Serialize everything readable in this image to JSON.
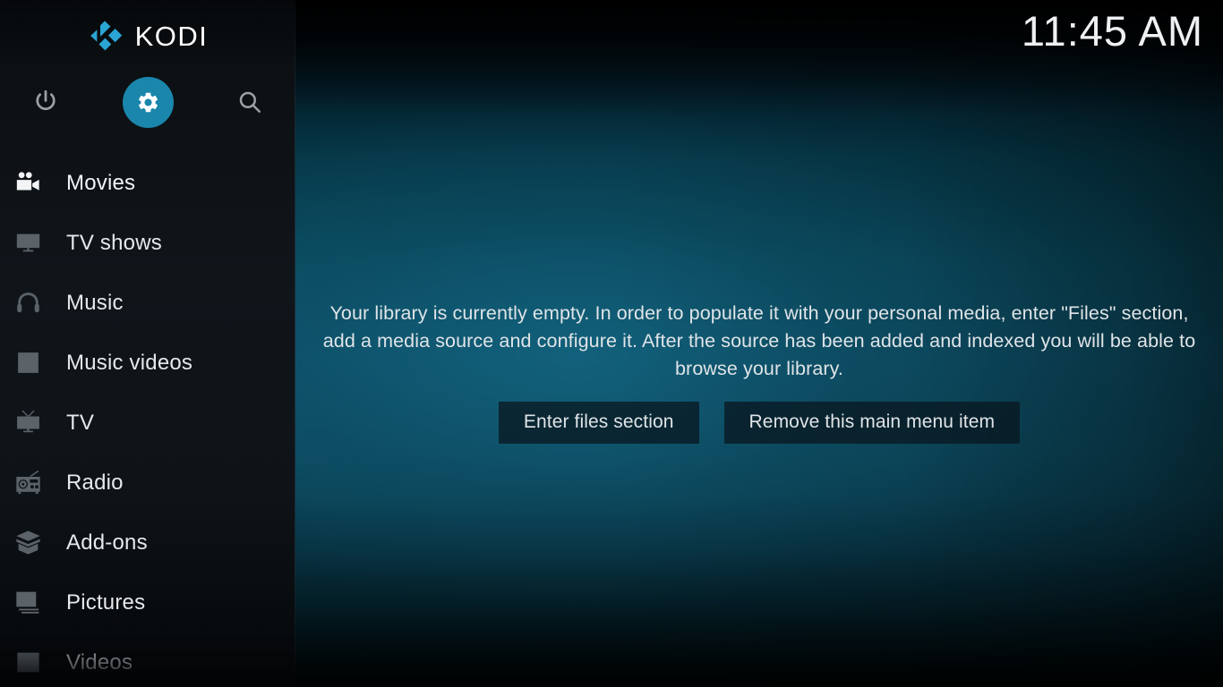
{
  "app": {
    "name": "KODI",
    "logo_icon": "kodi-logo-icon",
    "accent_color": "#1a86ab",
    "logo_color": "#2aa5d4"
  },
  "header": {
    "clock": "11:45 AM"
  },
  "top_actions": [
    {
      "id": "power",
      "icon": "power-icon",
      "label": "Power",
      "active": false
    },
    {
      "id": "settings",
      "icon": "gear-icon",
      "label": "Settings",
      "active": true
    },
    {
      "id": "search",
      "icon": "search-icon",
      "label": "Search",
      "active": false
    }
  ],
  "sidebar": {
    "items": [
      {
        "label": "Movies",
        "icon": "movie-camera-icon",
        "state": "selected"
      },
      {
        "label": "TV shows",
        "icon": "tv-monitor-icon",
        "state": "normal"
      },
      {
        "label": "Music",
        "icon": "headphones-icon",
        "state": "normal"
      },
      {
        "label": "Music videos",
        "icon": "film-music-icon",
        "state": "normal"
      },
      {
        "label": "TV",
        "icon": "retro-tv-icon",
        "state": "normal"
      },
      {
        "label": "Radio",
        "icon": "radio-icon",
        "state": "normal"
      },
      {
        "label": "Add-ons",
        "icon": "open-box-icon",
        "state": "normal"
      },
      {
        "label": "Pictures",
        "icon": "pictures-icon",
        "state": "normal"
      },
      {
        "label": "Videos",
        "icon": "film-strip-icon",
        "state": "dim"
      }
    ]
  },
  "main": {
    "empty_message": "Your library is currently empty. In order to populate it with your personal media, enter \"Files\" section, add a media source and configure it. After the source has been added and indexed you will be able to browse your library.",
    "buttons": {
      "enter_files": "Enter files section",
      "remove_item": "Remove this main menu item"
    }
  }
}
